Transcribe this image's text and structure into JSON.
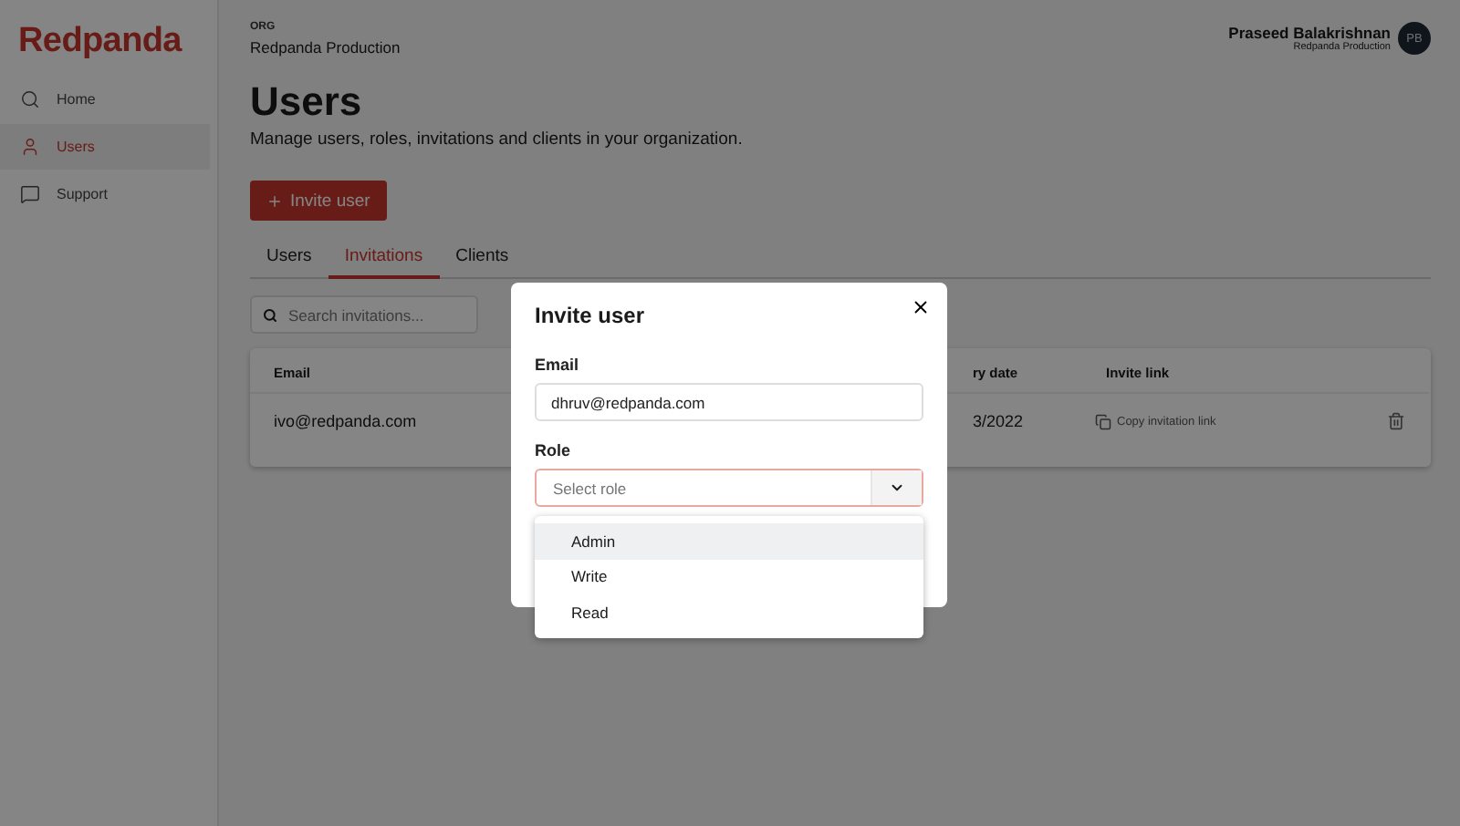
{
  "brand": "Redpanda",
  "sidebar": {
    "items": [
      {
        "label": "Home",
        "selected": false
      },
      {
        "label": "Users",
        "selected": true
      },
      {
        "label": "Support",
        "selected": false
      }
    ]
  },
  "header": {
    "org_label": "ORG",
    "org_name": "Redpanda Production",
    "user": {
      "name": "Praseed Balakrishnan",
      "org": "Redpanda Production",
      "initials": "PB"
    }
  },
  "page": {
    "title": "Users",
    "subtitle": "Manage users, roles, invitations and clients in your organization."
  },
  "invite_button": "Invite user",
  "tabs": [
    {
      "label": "Users",
      "selected": false
    },
    {
      "label": "Invitations",
      "selected": true
    },
    {
      "label": "Clients",
      "selected": false
    }
  ],
  "search": {
    "placeholder": "Search invitations..."
  },
  "table": {
    "columns": [
      "Email",
      "ry date",
      "Invite link"
    ],
    "rows": [
      {
        "email": "ivo@redpanda.com",
        "expiry": "3/2022",
        "link": "Copy invitation link"
      }
    ]
  },
  "modal": {
    "title": "Invite user",
    "email_label": "Email",
    "email_value": "dhruv@redpanda.com",
    "role_label": "Role",
    "role_placeholder": "Select role",
    "options": [
      {
        "label": "Admin",
        "selected": true
      },
      {
        "label": "Write",
        "selected": false
      },
      {
        "label": "Read",
        "selected": false
      }
    ]
  }
}
